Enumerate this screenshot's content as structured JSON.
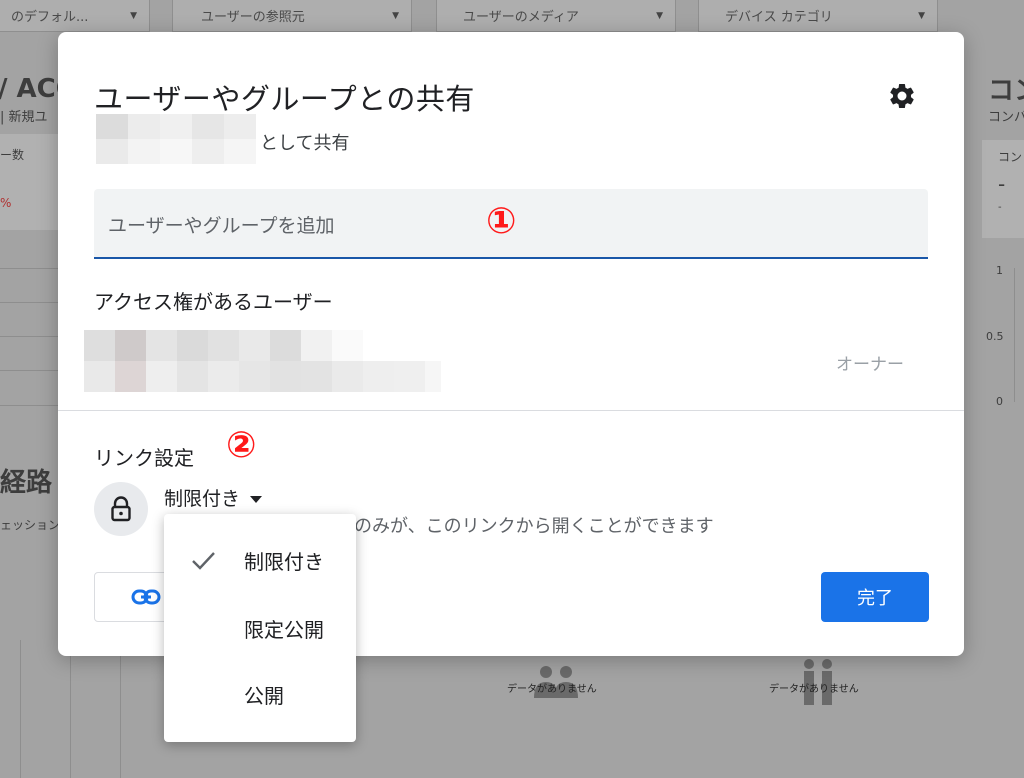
{
  "background": {
    "filters": [
      "のデフォル...",
      "ユーザーの参照元",
      "ユーザーのメディア",
      "デバイス カテゴリ"
    ],
    "left_heading": "/ ACQ",
    "left_sub": "| 新規ユ",
    "left_metric": "ー数",
    "left_pct": "%",
    "left_section": "経路",
    "left_session": "ェッション",
    "right_heading": "コン",
    "right_sub": "コンバ",
    "right_metric": "コン",
    "right_dash": "-",
    "right_dash_small": "-",
    "axis_ticks": [
      "1",
      "0.5",
      "0"
    ],
    "no_data_1": "データがありません",
    "no_data_2": "データがありません"
  },
  "dialog": {
    "title": "ユーザーやグループとの共有",
    "share_as": "として共有",
    "add_placeholder": "ユーザーやグループを追加",
    "badge_1": "①",
    "access_heading": "アクセス権があるユーザー",
    "owner_label": "オーナー",
    "link_heading": "リンク設定",
    "badge_2": "②",
    "restriction_label": "制限付き",
    "restriction_desc": "のみが、このリンクから開くことができます",
    "done_button": "完了",
    "icons": {
      "settings": "gear-icon",
      "lock": "lock-icon",
      "link": "link-icon",
      "check": "check-icon"
    },
    "accent_color": "#1a73e8",
    "badge_color": "#ff1a1a"
  },
  "menu": {
    "items": [
      {
        "label": "制限付き",
        "selected": true
      },
      {
        "label": "限定公開",
        "selected": false
      },
      {
        "label": "公開",
        "selected": false
      }
    ]
  }
}
